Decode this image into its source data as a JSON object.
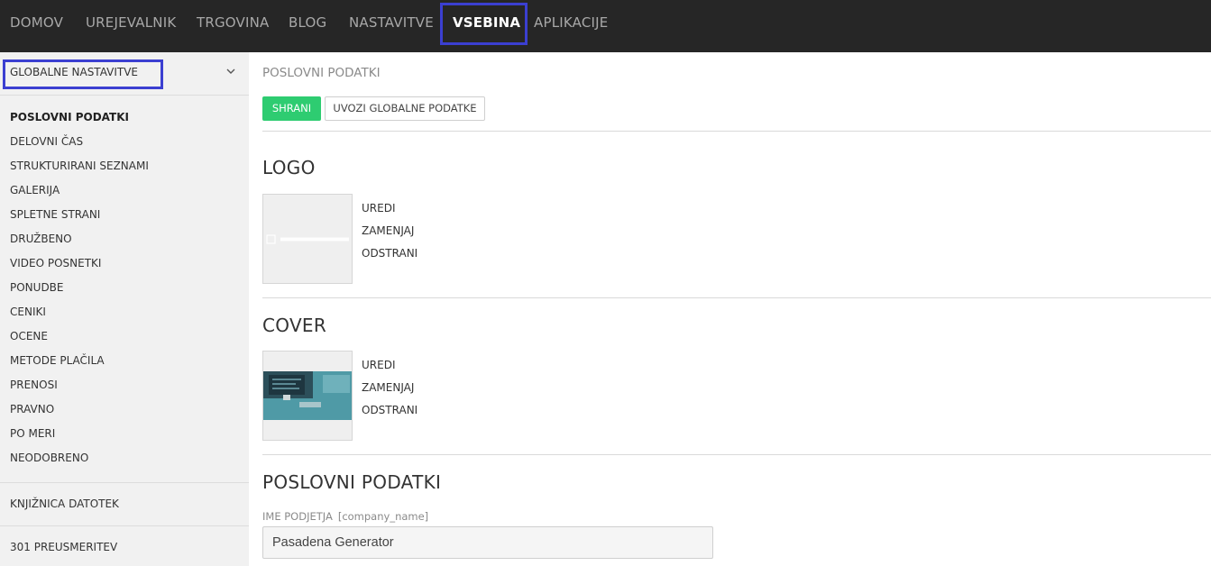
{
  "nav": {
    "items": [
      {
        "label": "DOMOV"
      },
      {
        "label": "UREJEVALNIK"
      },
      {
        "label": "TRGOVINA"
      },
      {
        "label": "BLOG"
      },
      {
        "label": "NASTAVITVE"
      },
      {
        "label": "VSEBINA",
        "active": true
      },
      {
        "label": "APLIKACIJE"
      }
    ]
  },
  "sidebar": {
    "select_label": "GLOBALNE NASTAVITVE",
    "items": [
      {
        "label": "POSLOVNI PODATKI",
        "active": true
      },
      {
        "label": "DELOVNI ČAS"
      },
      {
        "label": "STRUKTURIRANI SEZNAMI"
      },
      {
        "label": "GALERIJA"
      },
      {
        "label": "SPLETNE STRANI"
      },
      {
        "label": "DRUŽBENO"
      },
      {
        "label": "VIDEO POSNETKI"
      },
      {
        "label": "PONUDBE"
      },
      {
        "label": "CENIKI"
      },
      {
        "label": "OCENE"
      },
      {
        "label": "METODE PLAČILA"
      },
      {
        "label": "PRENOSI"
      },
      {
        "label": "PRAVNO"
      },
      {
        "label": "PO MERI"
      },
      {
        "label": "NEODOBRENO"
      }
    ],
    "library": "KNJIŽNICA DATOTEK",
    "redirects": "301 PREUSMERITEV"
  },
  "main": {
    "heading": "POSLOVNI PODATKI",
    "save_label": "SHRANI",
    "import_label": "UVOZI GLOBALNE PODATKE",
    "logo": {
      "title": "LOGO",
      "actions": [
        "UREDI",
        "ZAMENJAJ",
        "ODSTRANI"
      ]
    },
    "cover": {
      "title": "COVER",
      "actions": [
        "UREDI",
        "ZAMENJAJ",
        "ODSTRANI"
      ]
    },
    "business": {
      "title": "POSLOVNI PODATKI",
      "field_label": "IME PODJETJA",
      "field_tag": "[company_name]",
      "field_value": "Pasadena Generator"
    }
  },
  "colors": {
    "topbar": "#262626",
    "accent_green": "#2ecc71",
    "highlight_box": "#3b3fd1",
    "sidebar_bg": "#f1f1f1"
  }
}
